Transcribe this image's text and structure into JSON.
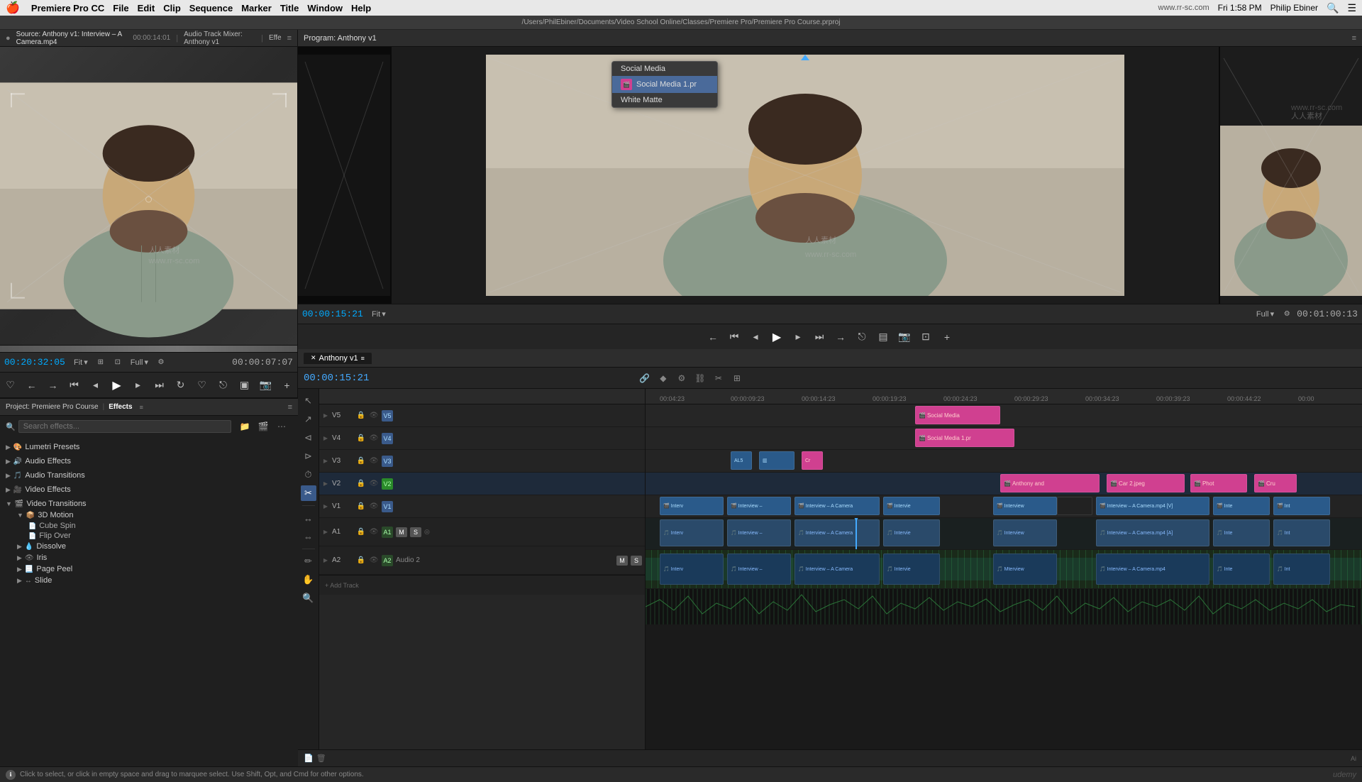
{
  "menubar": {
    "apple": "🍎",
    "app_name": "Premiere Pro CC",
    "menus": [
      "File",
      "Edit",
      "Clip",
      "Sequence",
      "Marker",
      "Title",
      "Window",
      "Help"
    ],
    "url_center": "www.rr-sc.com",
    "time": "Fri 1:58 PM",
    "user": "Philip Ebiner",
    "path": "/Users/PhilEbiner/Documents/Video School Online/Classes/Premiere Pro/Premiere Pro Course.prproj"
  },
  "source_monitor": {
    "title": "Source: Anthony v1: Interview – A Camera.mp4",
    "duration": "00:00:14:01",
    "tab2": "Audio Track Mixer: Anthony v1",
    "tab3": "Effe",
    "timecode": "00:20:32:05",
    "fit": "Fit",
    "duration_display": "00:00:07:07"
  },
  "program_monitor": {
    "title": "Program: Anthony v1",
    "timecode": "00:00:15:21",
    "fit": "Fit",
    "duration": "00:01:00:13",
    "fit_right": "Full"
  },
  "project_panel": {
    "title": "Project: Premiere Pro Course",
    "tab2": "Effects"
  },
  "effects": {
    "categories": [
      {
        "name": "Lumetri Presets",
        "icon": "▶",
        "expanded": false
      },
      {
        "name": "Audio Effects",
        "icon": "▶",
        "expanded": false
      },
      {
        "name": "Audio Transitions",
        "icon": "▶",
        "expanded": false
      },
      {
        "name": "Video Effects",
        "icon": "▶",
        "expanded": false
      },
      {
        "name": "Video Transitions",
        "icon": "▼",
        "expanded": true,
        "subcategories": [
          {
            "name": "3D Motion",
            "icon": "▼",
            "expanded": true,
            "items": [
              "Cube Spin",
              "Flip Over"
            ]
          },
          {
            "name": "Dissolve",
            "icon": "▶",
            "expanded": false,
            "items": []
          },
          {
            "name": "Iris",
            "icon": "▶",
            "expanded": false,
            "items": []
          },
          {
            "name": "Page Peel",
            "icon": "▶",
            "expanded": false,
            "items": []
          },
          {
            "name": "Slide",
            "icon": "▶",
            "expanded": false,
            "items": []
          }
        ]
      }
    ]
  },
  "timeline": {
    "sequence_name": "Anthony v1",
    "timecode": "00:00:15:21",
    "ruler_marks": [
      "00:04:23",
      "00:00:09:23",
      "00:00:14:23",
      "00:00:19:23",
      "00:00:24:23",
      "00:00:29:23",
      "00:00:34:23",
      "00:00:39:23",
      "00:00:44:22",
      "00:00"
    ],
    "tracks": [
      {
        "id": "V5",
        "type": "video",
        "name": "V5"
      },
      {
        "id": "V4",
        "type": "video",
        "name": "V4"
      },
      {
        "id": "V3",
        "type": "video",
        "name": "V3"
      },
      {
        "id": "V2",
        "type": "video",
        "name": "V2",
        "active": true
      },
      {
        "id": "V1",
        "type": "video",
        "name": "V1"
      },
      {
        "id": "A1",
        "type": "audio",
        "name": "A1",
        "label": "M S"
      },
      {
        "id": "A2",
        "type": "audio",
        "name": "A2",
        "label": "Audio 2"
      }
    ]
  },
  "context_menu": {
    "items": [
      {
        "label": "Social Media",
        "has_icon": false
      },
      {
        "label": "Social Media 1.pr",
        "has_icon": true
      },
      {
        "label": "White Matte",
        "has_icon": false
      }
    ]
  },
  "status_bar": {
    "message": "Click to select, or click in empty space and drag to marquee select. Use Shift, Opt, and Cmd for other options.",
    "right_label": "udemy"
  },
  "watermark": {
    "chinese": "人人素材",
    "url": "www.rr-sc.com",
    "logo": "Ai"
  }
}
